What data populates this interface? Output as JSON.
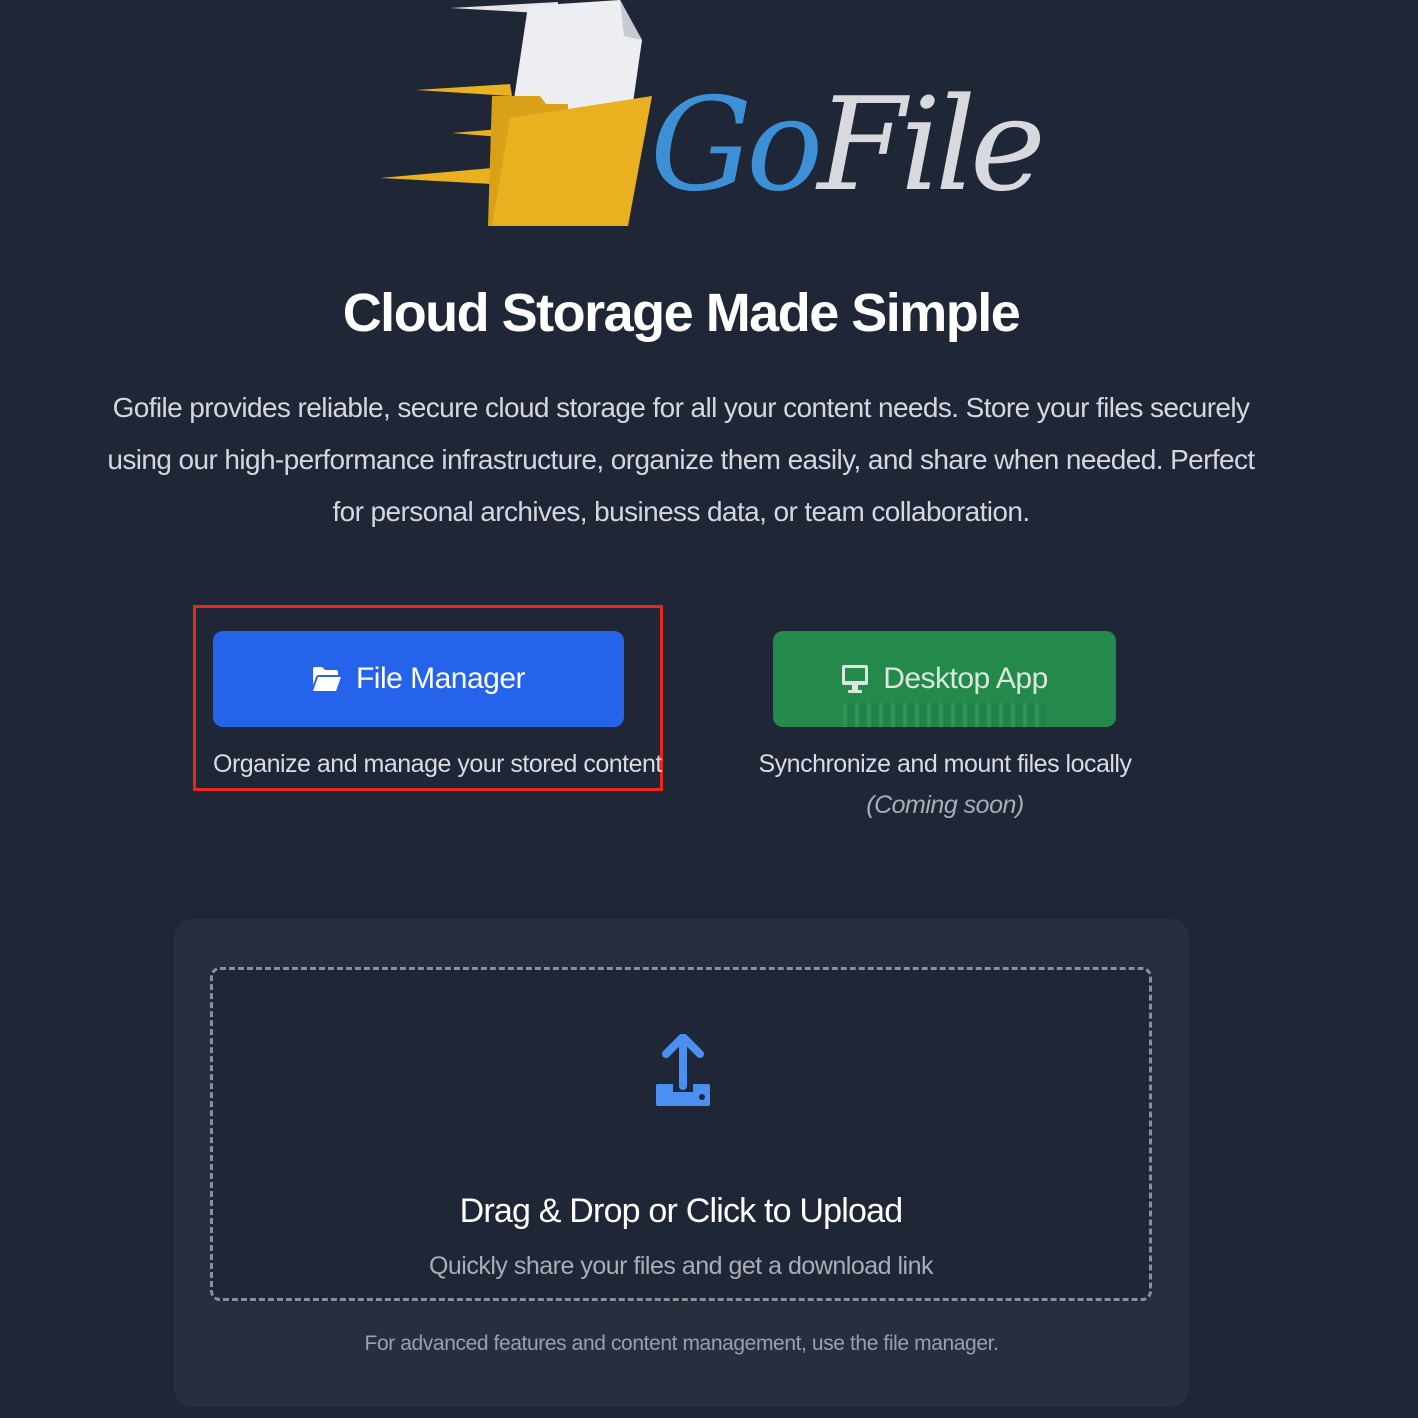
{
  "logo": {
    "word_go": "Go",
    "word_file": "File",
    "colors": {
      "go": "#3d8fd6",
      "file": "#d7d9de",
      "folder": "#e9b120",
      "paper": "#eceef1"
    }
  },
  "hero": {
    "headline": "Cloud Storage Made Simple",
    "description": "Gofile provides reliable, secure cloud storage for all your content needs. Store your files securely using our high-performance infrastructure, organize them easily, and share when needed. Perfect for personal archives, business data, or team collaboration."
  },
  "actions": {
    "file_manager": {
      "label": "File Manager",
      "icon": "folder-open-icon",
      "caption": "Organize and manage your stored content",
      "color": "#2563eb"
    },
    "desktop_app": {
      "label": "Desktop App",
      "icon": "desktop-icon",
      "caption": "Synchronize and mount files locally",
      "note": "(Coming soon)",
      "color": "#238a4b"
    },
    "highlight_color": "#e8261c"
  },
  "upload": {
    "icon": "upload-icon",
    "title": "Drag & Drop or Click to Upload",
    "subtitle": "Quickly share your files and get a download link",
    "footnote": "For advanced features and content management, use the file manager.",
    "accent": "#4b8ff0"
  }
}
